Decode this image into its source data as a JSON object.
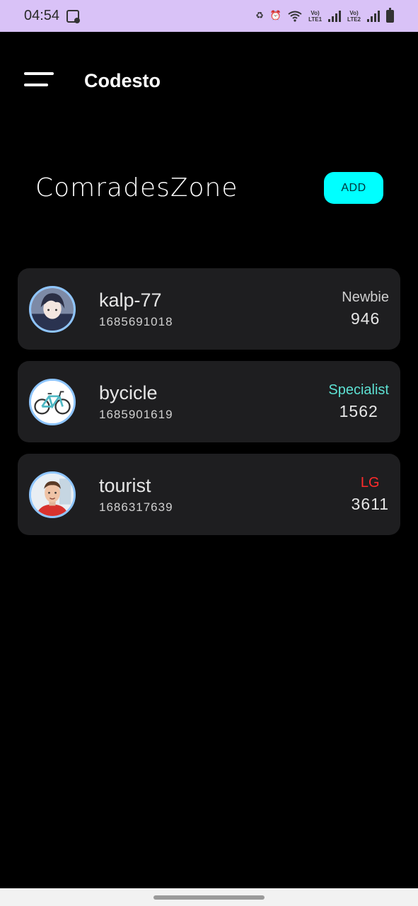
{
  "status_bar": {
    "time": "04:54",
    "net1": "Vo)\nLTE1",
    "net2": "Vo)\nLTE2"
  },
  "app_bar": {
    "title": "Codesto"
  },
  "header": {
    "title": "ComradesZone",
    "add_label": "ADD"
  },
  "users": [
    {
      "handle": "kalp-77",
      "id": "1685691018",
      "rank": "Newbie",
      "rating": "946",
      "rank_color": "#cfcfcf"
    },
    {
      "handle": "bycicle",
      "id": "1685901619",
      "rank": "Specialist",
      "rating": "1562",
      "rank_color": "#5de0d2"
    },
    {
      "handle": "tourist",
      "id": "1686317639",
      "rank": "LG",
      "rating": "3611",
      "rank_color": "#ff2b2b"
    }
  ]
}
